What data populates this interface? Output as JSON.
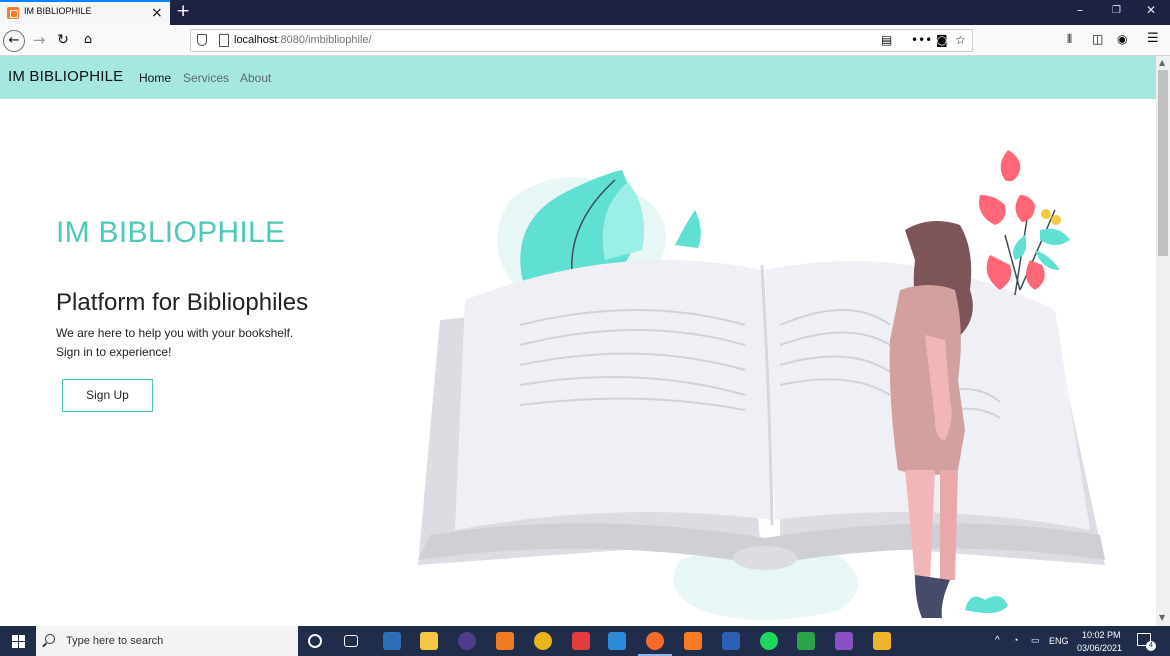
{
  "browser": {
    "tab_title": "IM BIBLIOPHILE",
    "url_host": "localhost",
    "url_rest": ":8080/imbibliophile/"
  },
  "site": {
    "brand": "IM BIBLIOPHILE",
    "nav": [
      "Home",
      "Services",
      "About"
    ]
  },
  "hero": {
    "title": "IM BIBLIOPHILE",
    "subtitle": "Platform for Bibliophiles",
    "line1": "We are here to help you with your bookshelf.",
    "line2": "Sign in to experience!",
    "button": "Sign Up"
  },
  "taskbar": {
    "search_placeholder": "Type here to search",
    "language": "ENG",
    "time": "10:02 PM",
    "date": "03/06/2021",
    "notifications": "4"
  },
  "colors": {
    "accent": "#4ec8b8",
    "navbar": "#a6e7e1"
  }
}
